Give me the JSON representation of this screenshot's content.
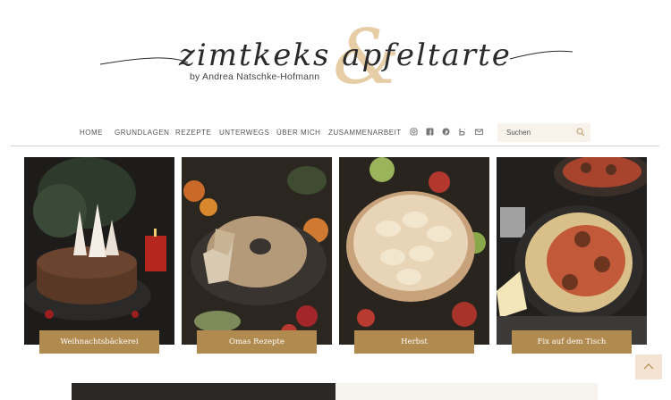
{
  "logo": {
    "script": "zimtkeks apfeltarte",
    "ampersand": "&",
    "byline": "by Andrea Natschke-Hofmann"
  },
  "nav": {
    "items": [
      "HOME",
      "GRUNDLAGEN",
      "REZEPTE",
      "UNTERWEGS",
      "ÜBER MICH",
      "ZUSAMMENARBEIT"
    ],
    "social": [
      "instagram-icon",
      "facebook-icon",
      "pinterest-icon",
      "bloglovin-icon",
      "email-icon"
    ]
  },
  "search": {
    "placeholder": "Suchen"
  },
  "tiles": [
    {
      "label": "Weihnachtsbäckerei",
      "image": "chocolate-cake-photo"
    },
    {
      "label": "Omas Rezepte",
      "image": "bundt-cake-photo"
    },
    {
      "label": "Herbst",
      "image": "apple-tart-photo"
    },
    {
      "label": "Fix auf dem Tisch",
      "image": "spaghetti-meatballs-photo"
    }
  ],
  "colors": {
    "accent": "#b08a4e",
    "ampersand": "#e6cda6",
    "search_bg": "#f7f2ea"
  }
}
